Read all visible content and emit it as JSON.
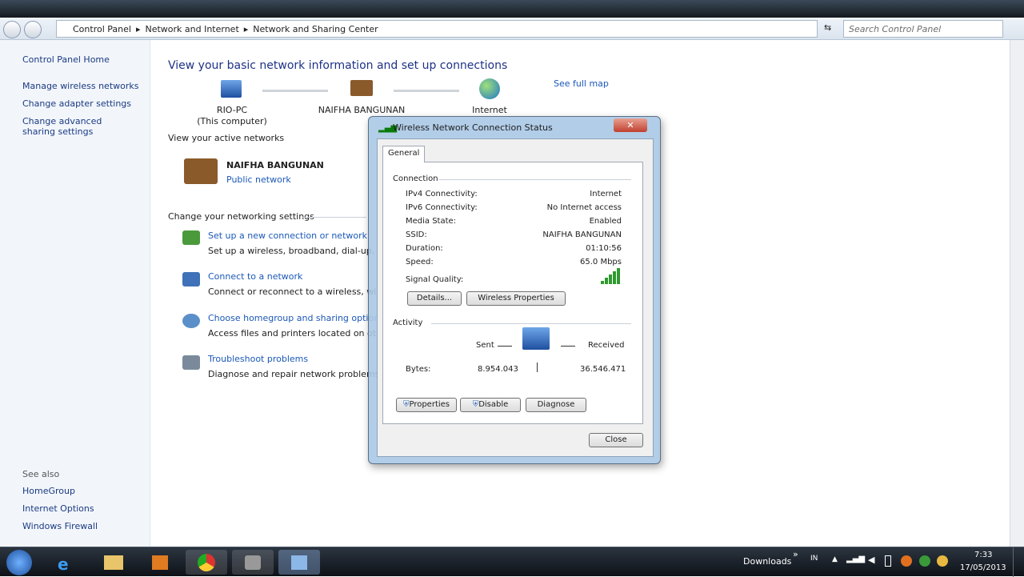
{
  "address": {
    "crumbs": [
      "Control Panel",
      "Network and Internet",
      "Network and Sharing Center"
    ],
    "search_placeholder": "Search Control Panel"
  },
  "sidebar": {
    "home": "Control Panel Home",
    "items": [
      "Manage wireless networks",
      "Change adapter settings",
      "Change advanced sharing settings"
    ],
    "see_also": "See also",
    "see_also_items": [
      "HomeGroup",
      "Internet Options",
      "Windows Firewall"
    ]
  },
  "main": {
    "title": "View your basic network information and set up connections",
    "see_full_map": "See full map",
    "map": [
      {
        "name": "RIO-PC",
        "sub": "(This computer)"
      },
      {
        "name": "NAIFHA BANGUNAN"
      },
      {
        "name": "Internet"
      }
    ],
    "active_networks_label": "View your active networks",
    "network_name": "NAIFHA BANGUNAN",
    "network_type": "Public network",
    "change_settings_label": "Change your networking settings",
    "tasks": [
      {
        "title": "Set up a new connection or network",
        "desc": "Set up a wireless, broadband, dial-up, ad"
      },
      {
        "title": "Connect to a network",
        "desc": "Connect or reconnect to a wireless, wired"
      },
      {
        "title": "Choose homegroup and sharing options",
        "desc": "Access files and printers located on other"
      },
      {
        "title": "Troubleshoot problems",
        "desc": "Diagnose and repair network problems, o"
      }
    ]
  },
  "dialog": {
    "title": "Wireless Network Connection Status",
    "tab": "General",
    "connection_label": "Connection",
    "rows": [
      {
        "k": "IPv4 Connectivity:",
        "v": "Internet"
      },
      {
        "k": "IPv6 Connectivity:",
        "v": "No Internet access"
      },
      {
        "k": "Media State:",
        "v": "Enabled"
      },
      {
        "k": "SSID:",
        "v": "NAIFHA BANGUNAN"
      },
      {
        "k": "Duration:",
        "v": "01:10:56"
      },
      {
        "k": "Speed:",
        "v": "65.0 Mbps"
      }
    ],
    "signal_label": "Signal Quality:",
    "signal_bars": 5,
    "details": "Details...",
    "wireless_properties": "Wireless Properties",
    "activity_label": "Activity",
    "sent": "Sent",
    "received": "Received",
    "bytes_label": "Bytes:",
    "bytes_sent": "8.954.043",
    "bytes_received": "36.546.471",
    "properties": "Properties",
    "disable": "Disable",
    "diagnose": "Diagnose",
    "close": "Close"
  },
  "taskbar": {
    "downloads": "Downloads",
    "lang": "IN",
    "time": "7:33",
    "date": "17/05/2013"
  }
}
